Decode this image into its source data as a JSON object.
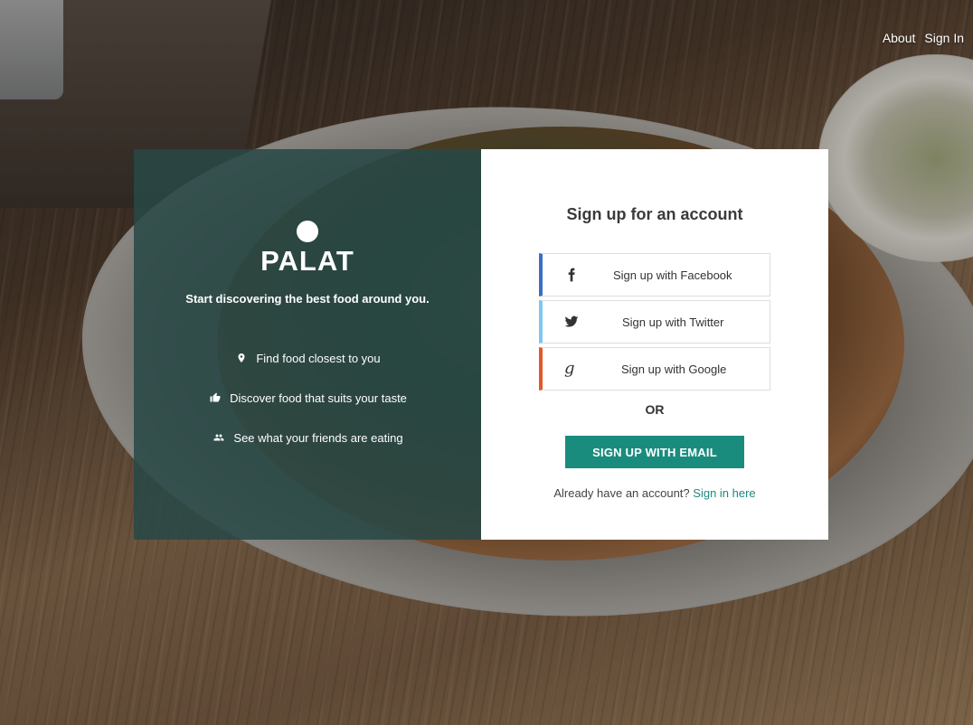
{
  "nav": {
    "about": "About",
    "sign_in": "Sign In"
  },
  "brand": {
    "name": "PALAT",
    "tagline": "Start discovering the best food around you."
  },
  "features": [
    {
      "icon": "location-pin-icon",
      "text": "Find food closest to you"
    },
    {
      "icon": "thumbs-up-icon",
      "text": "Discover food that suits your taste"
    },
    {
      "icon": "people-icon",
      "text": "See what your friends are eating"
    }
  ],
  "signup": {
    "title": "Sign up for an account",
    "facebook": "Sign up with Facebook",
    "twitter": "Sign up with Twitter",
    "google": "Sign up with Google",
    "or": "OR",
    "email_button": "SIGN UP WITH EMAIL",
    "already_text": "Already have an account?",
    "signin_link": "Sign in here"
  },
  "colors": {
    "accent": "#1a8c7e",
    "panel": "#284846",
    "facebook": "#3b6fc1",
    "twitter": "#7fc7ec",
    "google": "#e0592a"
  }
}
